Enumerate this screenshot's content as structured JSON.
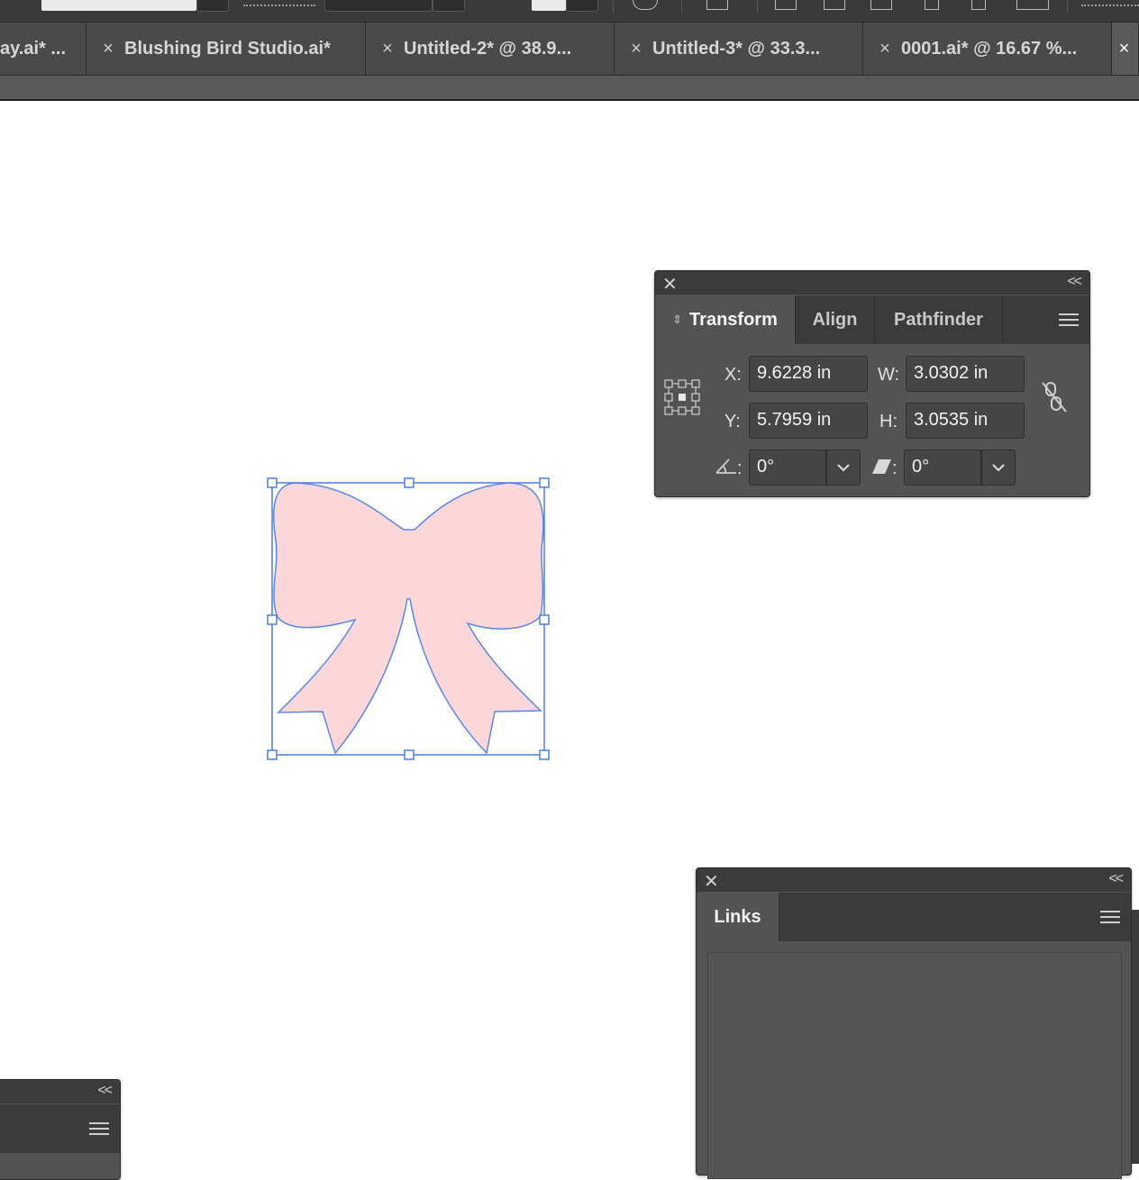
{
  "document_tabs": [
    {
      "label": "ay.ai* ...",
      "close": "×"
    },
    {
      "label": "Blushing Bird Studio.ai*",
      "close": "×"
    },
    {
      "label": "Untitled-2* @ 38.9...",
      "close": "×"
    },
    {
      "label": "Untitled-3* @ 33.3...",
      "close": "×"
    },
    {
      "label": "0001.ai* @ 16.67 %...",
      "close": "×"
    },
    {
      "label": "",
      "close": "×"
    }
  ],
  "artwork": {
    "name": "pink bow",
    "fill": "#fbd7d9",
    "stroke": "#5b87e6",
    "selection_color": "#4a7fe0"
  },
  "transform_panel": {
    "tabs": [
      "Transform",
      "Align",
      "Pathfinder"
    ],
    "active_tab": "Transform",
    "x_label": "X:",
    "x_value": "9.6228 in",
    "y_label": "Y:",
    "y_value": "5.7959 in",
    "w_label": "W:",
    "w_value": "3.0302 in",
    "h_label": "H:",
    "h_value": "3.0535 in",
    "rotate_label": ":",
    "rotate_value": "0°",
    "shear_label": ":",
    "shear_value": "0°"
  },
  "links_panel": {
    "tabs": [
      "Links"
    ]
  },
  "colors": {
    "ui_dark": "#3b3b3b",
    "ui_panel": "#535353",
    "canvas": "#ffffff"
  }
}
